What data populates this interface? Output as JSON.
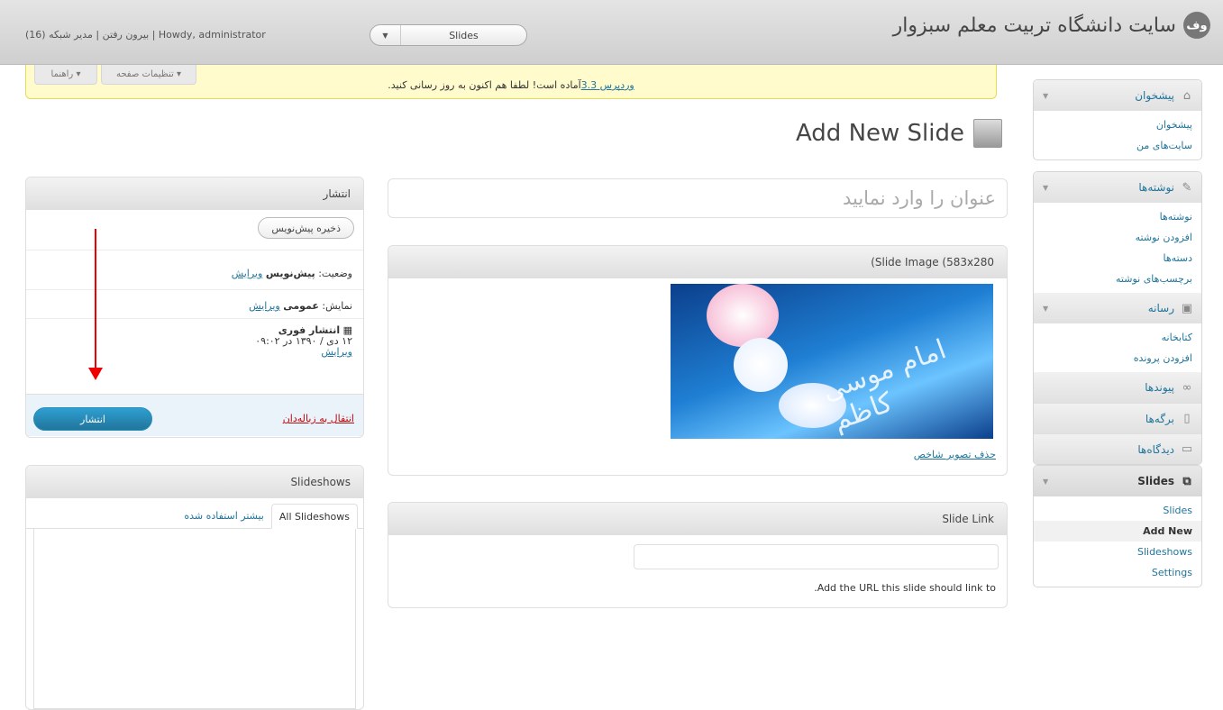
{
  "header": {
    "logo": "وف",
    "site_title": "سایت دانشگاه تربیت معلم سبزوار",
    "favorite_label": "Slides",
    "user": {
      "logout": "بیرون رفتن",
      "separator1": " | ",
      "role": "مدیر شبکه (16)",
      "separator2": " | ",
      "howdy": "Howdy,",
      "username": "administrator"
    }
  },
  "nag": {
    "text": "آماده است! لطفا هم اکنون به روز رسانی کنید.",
    "link_text": "وردپرس 3.3"
  },
  "screen_tabs": {
    "screen_options": "تنظیمات صفحه ▾",
    "help": "راهنما ▾"
  },
  "menu": {
    "dashboard": {
      "label": "پیشخوان",
      "items": [
        "پیشخوان",
        "سایت‌های من"
      ]
    },
    "posts": {
      "label": "نوشته‌ها",
      "items": [
        "نوشته‌ها",
        "افزودن نوشته",
        "دسته‌ها",
        "برچسب‌های نوشته"
      ]
    },
    "media": {
      "label": "رسانه",
      "items": [
        "کتابخانه",
        "افزودن پرونده"
      ]
    },
    "links": {
      "label": "پیوندها"
    },
    "pages": {
      "label": "برگه‌ها"
    },
    "comments": {
      "label": "دیدگاه‌ها"
    },
    "slides": {
      "label": "Slides",
      "items": [
        "Slides",
        "Add New",
        "Slideshows",
        "Settings"
      ]
    }
  },
  "page": {
    "title": "Add New Slide",
    "title_placeholder": "عنوان را وارد نمایید"
  },
  "slide_image": {
    "heading": "(Slide Image (583x280",
    "remove_link": "حذف تصویر شاخص",
    "image_text": "امام موسی کاظم"
  },
  "slide_link": {
    "heading": "Slide Link",
    "help": ".Add the URL this slide should link to",
    "value": ""
  },
  "publish": {
    "heading": "انتشار",
    "save_draft": "ذخیره پیش‌نویس",
    "status_label": "وضعیت: ",
    "status_value": "پیش‌نویس",
    "status_edit": "ویرایش",
    "visibility_label": "نمایش: ",
    "visibility_value": "عمومی",
    "visibility_edit": "ویرایش",
    "schedule_label": "انتشار فوری",
    "schedule_date": "۱۲ دی / ۱۳۹۰ در ۰۹:۰۲",
    "schedule_edit": "ویرایش",
    "trash": "انتقال به زباله‌دان",
    "publish_button": "انتشار"
  },
  "slideshows": {
    "heading": "Slideshows",
    "tab_all": "All Slideshows",
    "tab_popular": "بیشتر استفاده شده"
  },
  "colors": {
    "link": "#21759b",
    "annotation_arrow": "#e00000",
    "nag_bg": "#fffbcc"
  }
}
